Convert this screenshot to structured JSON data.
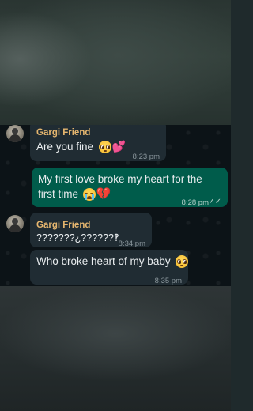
{
  "messages": [
    {
      "sender": "Gargi Friend",
      "text": "Are you fine",
      "emoji": [
        "pleading-face",
        "two-hearts"
      ],
      "time": "8:23 pm",
      "direction": "incoming"
    },
    {
      "line1": "My first love broke my heart for the",
      "line2": "first time",
      "emoji": [
        "loudly-crying-face",
        "broken-heart"
      ],
      "time": "8:28 pm",
      "status": "read",
      "direction": "outgoing"
    },
    {
      "sender": "Gargi Friend",
      "text": "???????¿??????‽",
      "time": "8:34 pm",
      "direction": "incoming"
    },
    {
      "text": "Who broke heart of my baby",
      "emoji": [
        "pleading-face"
      ],
      "time": "8:35 pm",
      "direction": "incoming"
    }
  ],
  "colors": {
    "incoming_bubble": "#202c33",
    "outgoing_bubble": "#005c4b",
    "sender_name": "#e5b66f",
    "read_ticks": "#53bdeb",
    "chat_background": "#0c1317"
  },
  "icons": {
    "read_status": "double-check-icon",
    "two_hearts_glyph": "💕",
    "broken_heart_glyph": "💔",
    "ticks_glyph": "✓✓"
  }
}
